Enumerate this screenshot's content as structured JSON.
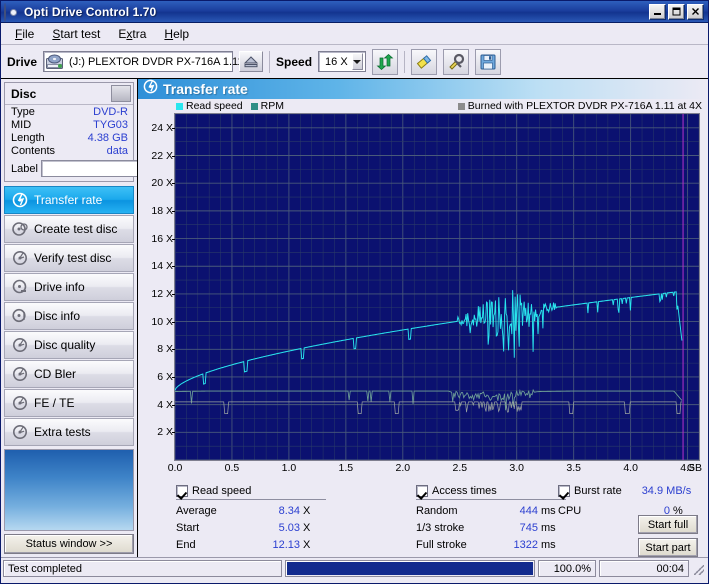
{
  "window": {
    "title": "Opti Drive Control 1.70",
    "icon": "cd-disc-icon",
    "minimize_label": "_",
    "maximize_label": "□",
    "close_label": "✕"
  },
  "menubar": {
    "items": [
      {
        "label": "File",
        "accel": "F"
      },
      {
        "label": "Start test",
        "accel": "S"
      },
      {
        "label": "Extra",
        "accel": "x"
      },
      {
        "label": "Help",
        "accel": "H"
      }
    ]
  },
  "toolbar": {
    "drive_label": "Drive",
    "drive_value": "(J:)   PLEXTOR DVDR   PX-716A 1.11",
    "eject_icon": "eject-icon",
    "speed_label": "Speed",
    "speed_value": "16 X",
    "refresh_icon": "refresh-icon",
    "erase_icon": "eraser-icon",
    "tools_icon": "tools-icon",
    "save_icon": "save-disk-icon"
  },
  "disc": {
    "title": "Disc",
    "rows": [
      {
        "key": "Type",
        "value": "DVD-R"
      },
      {
        "key": "MID",
        "value": "TYG03"
      },
      {
        "key": "Length",
        "value": "4.38 GB"
      },
      {
        "key": "Contents",
        "value": "data"
      }
    ],
    "label_key": "Label",
    "label_value": "",
    "label_placeholder": "",
    "label_button_icon": "disc-refresh-icon"
  },
  "sidebar": {
    "items": [
      {
        "label": "Transfer rate",
        "icon": "transfer-rate-icon",
        "active": true
      },
      {
        "label": "Create test disc",
        "icon": "create-disc-icon",
        "active": false
      },
      {
        "label": "Verify test disc",
        "icon": "verify-disc-icon",
        "active": false
      },
      {
        "label": "Drive info",
        "icon": "drive-info-icon",
        "active": false
      },
      {
        "label": "Disc info",
        "icon": "disc-info-icon",
        "active": false
      },
      {
        "label": "Disc quality",
        "icon": "disc-quality-icon",
        "active": false
      },
      {
        "label": "CD Bler",
        "icon": "cd-bler-icon",
        "active": false
      },
      {
        "label": "FE / TE",
        "icon": "fe-te-icon",
        "active": false
      },
      {
        "label": "Extra tests",
        "icon": "extra-tests-icon",
        "active": false
      }
    ],
    "status_window_label": "Status window >>"
  },
  "panel": {
    "title": "Transfer rate",
    "icon": "transfer-rate-icon"
  },
  "chart_data": {
    "type": "line",
    "title": "Transfer rate",
    "xlabel": "GB",
    "ylabel": "X",
    "xlim": [
      0.0,
      4.6
    ],
    "ylim": [
      0,
      25
    ],
    "grid": true,
    "x_unit_suffix": "GB",
    "xticks": [
      0.0,
      0.5,
      1.0,
      1.5,
      2.0,
      2.5,
      3.0,
      3.5,
      4.0,
      4.5
    ],
    "xtick_labels": [
      "0.0",
      "0.5",
      "1.0",
      "1.5",
      "2.0",
      "2.5",
      "3.0",
      "3.5",
      "4.0",
      "4.5"
    ],
    "yticks": [
      2,
      4,
      6,
      8,
      10,
      12,
      14,
      16,
      18,
      20,
      22,
      24
    ],
    "ytick_labels": [
      "2 X",
      "4 X",
      "6 X",
      "8 X",
      "10 X",
      "12 X",
      "14 X",
      "16 X",
      "18 X",
      "20 X",
      "22 X",
      "24 X"
    ],
    "legend_position": "top",
    "legend": [
      {
        "name": "Read speed",
        "color": "#29e6ee"
      },
      {
        "name": "RPM",
        "color": "#2f8f86"
      }
    ],
    "annotation": {
      "text": "Burned with PLEXTOR DVDR   PX-716A 1.11 at 4X",
      "marker_color": "#8c8c8c"
    },
    "series": [
      {
        "name": "Read speed",
        "color": "#29e6ee",
        "x": [
          0.0,
          0.1,
          0.2,
          0.3,
          0.4,
          0.5,
          0.6,
          0.7,
          0.8,
          0.9,
          1.0,
          1.1,
          1.2,
          1.3,
          1.4,
          1.5,
          1.6,
          1.7,
          1.8,
          1.9,
          2.0,
          2.1,
          2.2,
          2.3,
          2.4,
          2.5,
          2.6,
          2.7,
          2.8,
          2.9,
          3.0,
          3.1,
          3.2,
          3.3,
          3.4,
          3.5,
          3.6,
          3.7,
          3.8,
          3.9,
          4.0,
          4.1,
          4.2,
          4.3,
          4.38,
          4.45
        ],
        "y": [
          5.03,
          5.28,
          5.62,
          5.93,
          6.21,
          6.48,
          6.74,
          6.99,
          7.22,
          7.44,
          7.66,
          7.86,
          8.06,
          8.25,
          8.43,
          8.61,
          8.78,
          8.95,
          9.11,
          9.27,
          9.42,
          9.56,
          9.71,
          9.3,
          9.85,
          9.4,
          9.2,
          9.6,
          9.1,
          9.9,
          10.2,
          10.05,
          10.45,
          10.7,
          10.55,
          10.95,
          11.1,
          11.25,
          11.4,
          11.55,
          11.7,
          11.85,
          11.95,
          12.05,
          12.13,
          8.6
        ]
      },
      {
        "name": "RPM",
        "color": "#6f9f96",
        "x": [
          0.0,
          0.3,
          0.6,
          0.9,
          1.2,
          1.5,
          1.8,
          2.1,
          2.4,
          2.5,
          2.6,
          2.7,
          2.8,
          2.9,
          3.0,
          3.2,
          3.5,
          3.8,
          4.1,
          4.38,
          4.45
        ],
        "y": [
          4.95,
          4.98,
          4.98,
          4.98,
          4.98,
          4.98,
          4.98,
          4.98,
          4.98,
          4.7,
          4.55,
          4.65,
          4.5,
          4.6,
          4.75,
          4.95,
          4.98,
          4.98,
          4.98,
          4.98,
          4.3
        ]
      }
    ],
    "baseline_y": 4.2
  },
  "stats": {
    "read_speed": {
      "checked": true,
      "title": "Read speed",
      "rows": [
        {
          "key": "Average",
          "value": "8.34",
          "unit": "X"
        },
        {
          "key": "Start",
          "value": "5.03",
          "unit": "X"
        },
        {
          "key": "End",
          "value": "12.13",
          "unit": "X"
        }
      ]
    },
    "access_times": {
      "checked": true,
      "title": "Access times",
      "rows": [
        {
          "key": "Random",
          "value": "444",
          "unit": "ms"
        },
        {
          "key": "1/3 stroke",
          "value": "745",
          "unit": "ms"
        },
        {
          "key": "Full stroke",
          "value": "1322",
          "unit": "ms"
        }
      ]
    },
    "burst_rate": {
      "checked": true,
      "title": "Burst rate",
      "value": "34.9 MB/s",
      "rows": [
        {
          "key": "CPU",
          "value": "0",
          "unit": "%"
        }
      ]
    },
    "buttons": [
      {
        "label": "Start full"
      },
      {
        "label": "Start part"
      }
    ]
  },
  "statusbar": {
    "message": "Test completed",
    "percent_text": "100.0%",
    "percent_value": 100,
    "elapsed": "00:04"
  },
  "colors": {
    "accent": "#2b3fd0",
    "chart_bg": "#0b1170",
    "read_speed": "#29e6ee",
    "rpm": "#6f9f96",
    "title_bar": "#1b3f9e"
  }
}
